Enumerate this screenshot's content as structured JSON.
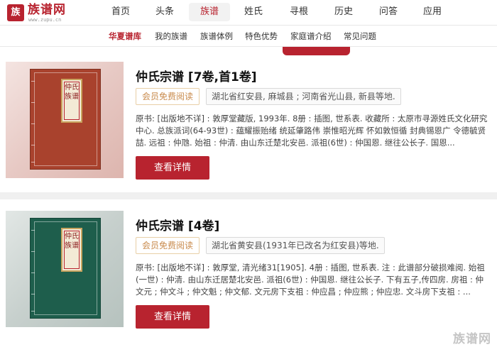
{
  "site": {
    "logo_badge": "族",
    "logo_name": "族谱网",
    "logo_url": "www.zupu.cn",
    "brand_color": "#b8232f"
  },
  "nav": {
    "items": [
      {
        "label": "首页"
      },
      {
        "label": "头条"
      },
      {
        "label": "族谱",
        "active": true
      },
      {
        "label": "姓氏"
      },
      {
        "label": "寻根"
      },
      {
        "label": "历史"
      },
      {
        "label": "问答"
      },
      {
        "label": "应用"
      }
    ]
  },
  "subnav": {
    "items": [
      {
        "label": "华夏谱库",
        "active": true
      },
      {
        "label": "我的族谱"
      },
      {
        "label": "族谱体例"
      },
      {
        "label": "特色优势"
      },
      {
        "label": "家庭谱介绍"
      },
      {
        "label": "常见问题"
      }
    ]
  },
  "results": [
    {
      "cover_label": "仲氏\n族谱",
      "cover_color": "#a9422d",
      "title": "仲氏宗谱 [7卷,首1卷]",
      "free_tag": "会员免费阅读",
      "location": "湖北省红安县, 麻城县 ; 河南省光山县, 新县等地.",
      "description": "原书: [出版地不详] : 敦厚堂藏版, 1993年. 8册 : 插图, 世系表. 收藏所 : 太原市寻源姓氏文化研究中心. 总族派词(64-93世) : 蕴耀振贻绪 统延肇路伟 崇惟昭光辉 怀如敦恒循 封典锡恩广 令德毓贤喆. 远祖 : 仲虺. 始祖 : 仲清. 由山东迁楚北安邑. 派祖(6世) : 仲国恩. 继往公长子. 国恩...",
      "button": "查看详情"
    },
    {
      "cover_label": "仲氏\n族谱",
      "cover_color": "#1e5e4c",
      "title": "仲氏宗谱 [4卷]",
      "free_tag": "会员免费阅读",
      "location": "湖北省黄安县(1931年已改名为红安县)等地.",
      "description": "原书: [出版地不详] : 敦厚堂, 清光绪31[1905]. 4册 : 插图, 世系表. 注 : 此谱部分破损难阅. 始祖(一世) : 仲清. 由山东迁居楚北安邑. 派祖(6世) : 仲国恩. 继往公长子. 下有五子,传四房. 房祖 : 仲文元 ; 仲文斗 ; 仲文魁 ; 仲文郁. 文元房下支祖 : 仲应昌 ; 仲应熊 ; 仲应忠. 文斗房下支祖 : ...",
      "button": "查看详情"
    }
  ],
  "watermark": "族谱网"
}
